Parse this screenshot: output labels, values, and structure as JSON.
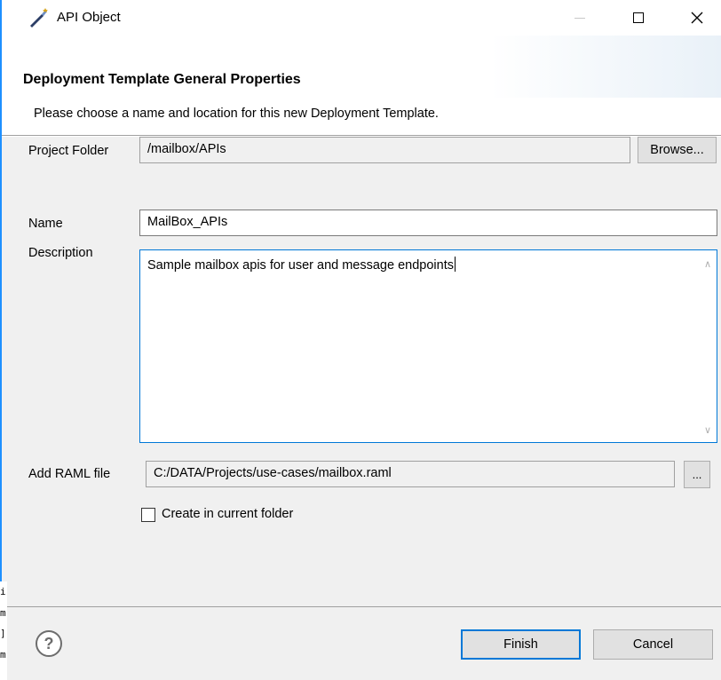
{
  "window": {
    "title": "API Object",
    "icon": "wand-icon"
  },
  "header": {
    "title": "Deployment Template General Properties",
    "description": "Please choose a name and location for this new Deployment Template."
  },
  "form": {
    "project_folder": {
      "label": "Project Folder",
      "value": "/mailbox/APIs",
      "browse_label": "Browse..."
    },
    "name": {
      "label": "Name",
      "value": "MailBox_APIs"
    },
    "description": {
      "label": "Description",
      "value": "Sample mailbox apis for user and message endpoints"
    },
    "raml_file": {
      "label": "Add RAML file",
      "value": "C:/DATA/Projects/use-cases/mailbox.raml",
      "browse_label": "..."
    },
    "create_in_current_folder": {
      "label": "Create in current folder",
      "checked": false
    }
  },
  "footer": {
    "help_glyph": "?",
    "finish_label": "Finish",
    "cancel_label": "Cancel"
  },
  "background_glyphs": [
    "i",
    "m",
    "]",
    "m"
  ],
  "colors": {
    "focus_accent": "#0078d7",
    "window_bg": "#f0f0f0"
  }
}
